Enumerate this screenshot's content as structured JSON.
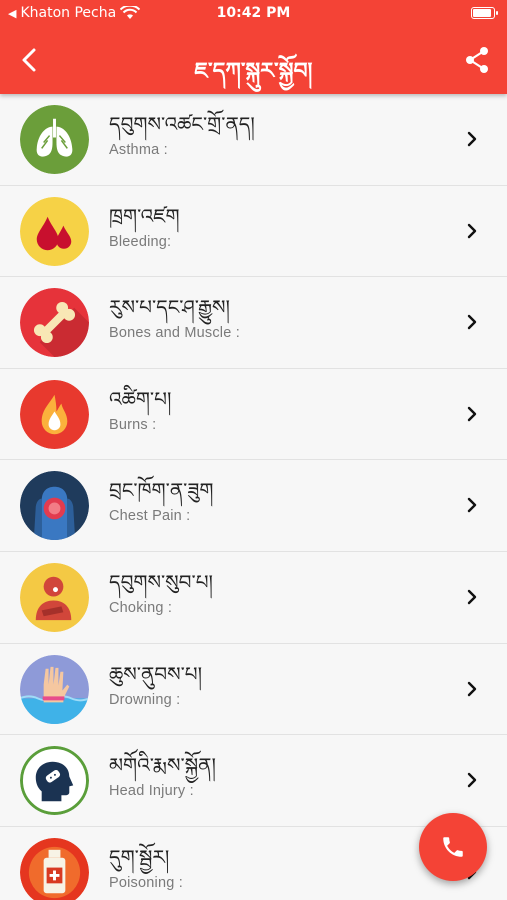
{
  "status": {
    "carrier": "Khaton Pecha",
    "time": "10:42 PM"
  },
  "header": {
    "title": "ཇ་དཀ་སྐུར་སྐྱོབ།"
  },
  "colors": {
    "accent": "#f44336"
  },
  "items": [
    {
      "bo": "དབུགས་འཚང་གྲོ་ནད།",
      "en": "Asthma :",
      "icon": "lungs-icon"
    },
    {
      "bo": "ཁྲག་འཛག",
      "en": "Bleeding:",
      "icon": "blood-drops-icon"
    },
    {
      "bo": "རུས་པ་དང་ཤ་རྒྱུས།",
      "en": "Bones and Muscle :",
      "icon": "bone-icon"
    },
    {
      "bo": "འཚིག་པ།",
      "en": "Burns :",
      "icon": "flame-icon"
    },
    {
      "bo": "བྲང་ཁོག་ན་ཟུག",
      "en": "Chest Pain :",
      "icon": "chest-pain-icon"
    },
    {
      "bo": "དབུགས་སུབ་པ།",
      "en": "Choking :",
      "icon": "choking-person-icon"
    },
    {
      "bo": "ཆུས་ནུབས་པ།",
      "en": "Drowning :",
      "icon": "drowning-hand-icon"
    },
    {
      "bo": "མགོའི་རྨས་སྐྱོན།",
      "en": "Head Injury :",
      "icon": "head-injury-icon"
    },
    {
      "bo": "དུག་སྦྱོར།",
      "en": "Poisoning :",
      "icon": "poison-bottle-icon"
    }
  ],
  "fab": {
    "icon": "phone-icon"
  }
}
